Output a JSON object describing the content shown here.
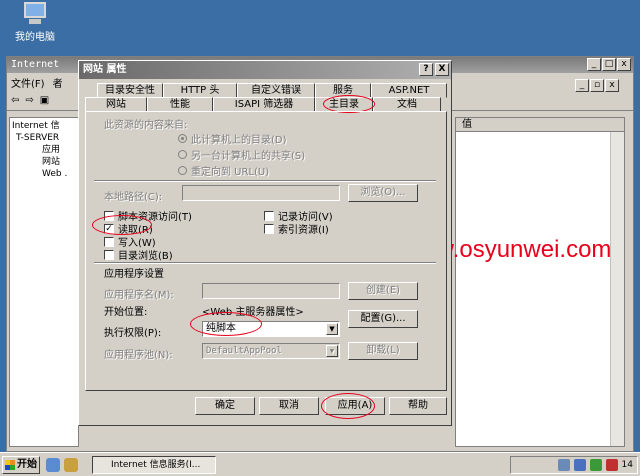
{
  "desktop": {
    "icon_label": "我的电脑",
    "watermark_url": "www.osyunwei.com"
  },
  "bgwindow": {
    "title": "Internet",
    "menu": [
      "文件(F)",
      "者"
    ],
    "tree": [
      "Internet 信",
      "T-SERVER",
      "应用",
      "网站",
      "Web ."
    ],
    "list_header": "值"
  },
  "dialog": {
    "title": "网站 属性",
    "help_btn": "?",
    "close_btn": "X",
    "tabs_back": [
      "目录安全性",
      "HTTP 头",
      "自定义错误",
      "服务",
      "ASP.NET"
    ],
    "tabs_front": [
      "网站",
      "性能",
      "ISAPI 筛选器",
      "主目录",
      "文档"
    ],
    "source_label": "此资源的内容来自:",
    "radios": [
      "此计算机上的目录(D)",
      "另一台计算机上的共享(S)",
      "重定向到 URL(U)"
    ],
    "local_path_label": "本地路径(C):",
    "local_path_value": "",
    "browse_btn": "浏览(O)...",
    "checks_left": [
      {
        "label": "脚本资源访问(T)",
        "checked": false
      },
      {
        "label": "读取(R)",
        "checked": true
      },
      {
        "label": "写入(W)",
        "checked": false
      },
      {
        "label": "目录浏览(B)",
        "checked": false
      }
    ],
    "checks_right": [
      {
        "label": "记录访问(V)",
        "checked": false
      },
      {
        "label": "索引资源(I)",
        "checked": false
      }
    ],
    "app_settings_label": "应用程序设置",
    "app_name_label": "应用程序名(M):",
    "app_name_value": "",
    "create_btn": "创建(E)",
    "start_pos_label": "开始位置:",
    "start_pos_value": "<Web 主服务器属性>",
    "config_btn": "配置(G)...",
    "exec_perm_label": "执行权限(P):",
    "exec_perm_value": "纯脚本",
    "app_pool_label": "应用程序池(N):",
    "app_pool_value": "DefaultAppPool",
    "unload_btn": "卸载(L)",
    "ok_btn": "确定",
    "cancel_btn": "取消",
    "apply_btn": "应用(A)",
    "help_footer_btn": "帮助"
  },
  "taskbar": {
    "start_label": "开始",
    "task_label": "Internet 信息服务(I...",
    "clock": "14"
  },
  "colors": {
    "annotation": "#e8001c",
    "desktop": "#3a6ea5",
    "face": "#d4d0c8"
  }
}
